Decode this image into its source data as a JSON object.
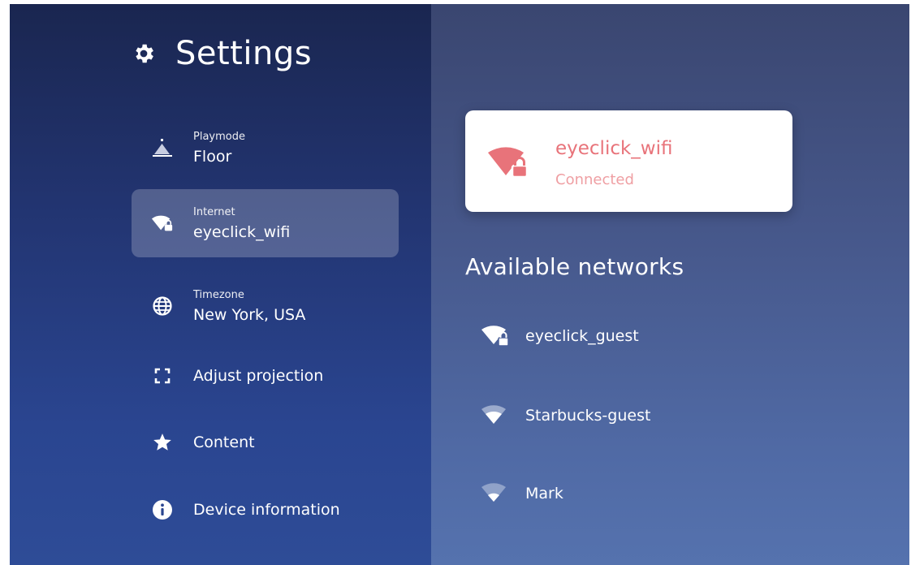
{
  "app": {
    "title": "Settings",
    "title_icon": "gear-icon"
  },
  "sidebar": {
    "items": [
      {
        "caption": "Playmode",
        "value": "Floor",
        "icon": "playmode-icon",
        "active": false
      },
      {
        "caption": "Internet",
        "value": "eyeclick_wifi",
        "icon": "wifi-lock-icon",
        "active": true
      },
      {
        "caption": "Timezone",
        "value": "New York, USA",
        "icon": "globe-icon",
        "active": false
      },
      {
        "label": "Adjust projection",
        "icon": "frame-corners-icon"
      },
      {
        "label": "Content",
        "icon": "star-icon"
      },
      {
        "label": "Device information",
        "icon": "info-icon"
      }
    ]
  },
  "internet": {
    "connected": {
      "name": "eyeclick_wifi",
      "status": "Connected",
      "icon": "wifi-lock-icon"
    },
    "available_title": "Available networks",
    "networks": [
      {
        "name": "eyeclick_guest",
        "icon": "wifi-lock-icon"
      },
      {
        "name": "Starbucks-guest",
        "icon": "wifi-icon"
      },
      {
        "name": "Mark",
        "icon": "wifi-icon"
      }
    ]
  },
  "colors": {
    "accent": "#e8737a",
    "accent_light": "#ef9fa3",
    "sidebar_top": "#1a2650",
    "sidebar_bottom": "#2e4c97",
    "main_top": "#3a4670",
    "main_bottom": "#5572ae"
  }
}
